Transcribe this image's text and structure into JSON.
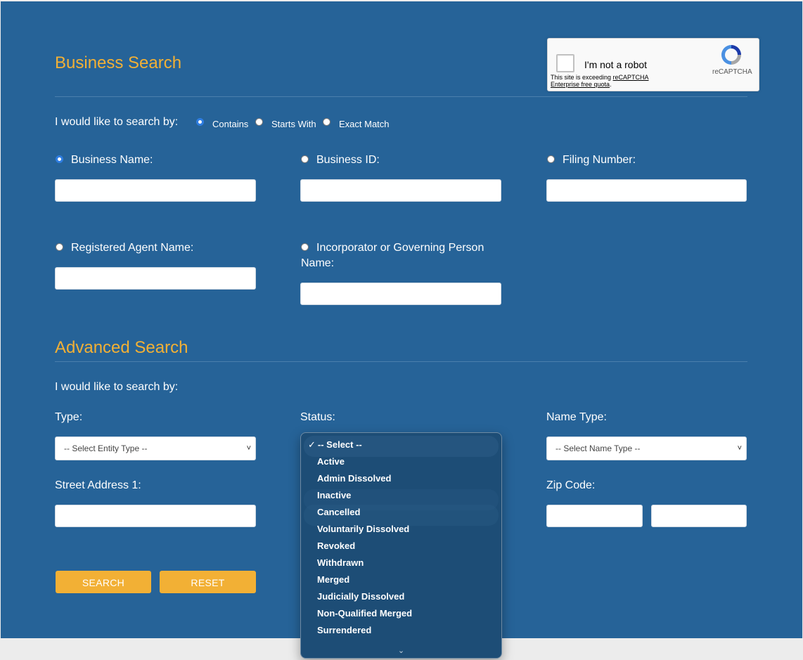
{
  "business_search": {
    "title": "Business Search",
    "search_by_label": "I would like to search by:",
    "match_options": [
      {
        "label": "Contains",
        "selected": true
      },
      {
        "label": "Starts With",
        "selected": false
      },
      {
        "label": "Exact Match",
        "selected": false
      }
    ],
    "fields": {
      "business_name": {
        "label": "Business Name:",
        "selected": true,
        "value": ""
      },
      "business_id": {
        "label": "Business ID:",
        "selected": false,
        "value": ""
      },
      "filing_number": {
        "label": "Filing Number:",
        "selected": false,
        "value": ""
      },
      "registered_agent": {
        "label": "Registered Agent Name:",
        "selected": false,
        "value": ""
      },
      "incorporator": {
        "label": "Incorporator or Governing Person Name:",
        "selected": false,
        "value": ""
      }
    }
  },
  "recaptcha": {
    "label": "I'm not a robot",
    "brand": "reCAPTCHA",
    "warning_prefix": "This site is exceeding ",
    "warning_link": "reCAPTCHA Enterprise free quota",
    "warning_suffix": "."
  },
  "advanced_search": {
    "title": "Advanced Search",
    "search_by_label": "I would like to search by:",
    "type": {
      "label": "Type:",
      "value": "-- Select Entity Type --"
    },
    "status": {
      "label": "Status:",
      "value": "-- Select --"
    },
    "name_type": {
      "label": "Name Type:",
      "value": "-- Select Name Type --"
    },
    "street_address": {
      "label": "Street Address 1:",
      "value": ""
    },
    "zip_code": {
      "label": "Zip Code:",
      "value": "",
      "value_ext": ""
    }
  },
  "buttons": {
    "search": "SEARCH",
    "reset": "RESET"
  },
  "status_dropdown": {
    "options": [
      "-- Select --",
      "Active",
      "Admin Dissolved",
      "Inactive",
      "Cancelled",
      "Voluntarily Dissolved",
      "Revoked",
      "Withdrawn",
      "Merged",
      "Judicially Dissolved",
      "Non-Qualified Merged",
      "Surrendered"
    ],
    "selected_index": 0,
    "selected_mark": "✓",
    "scroll_more_icon": "chevron-down-icon"
  },
  "colors": {
    "panel": "#266398",
    "accent": "#f2b035",
    "page_bg": "#ececec"
  }
}
